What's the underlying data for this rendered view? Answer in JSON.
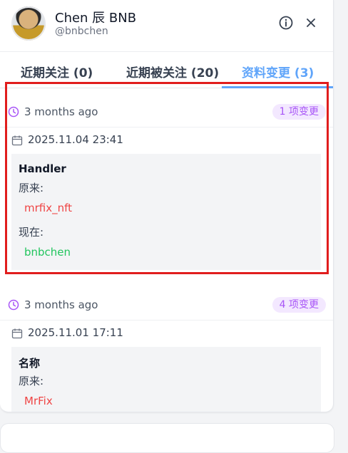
{
  "profile": {
    "name": "Chen 辰 BNB",
    "handle": "@bnbchen"
  },
  "header_icons": [
    "info-icon",
    "close-icon"
  ],
  "tabs": [
    {
      "label": "近期关注 (0)",
      "active": false
    },
    {
      "label": "近期被关注 (20)",
      "active": false
    },
    {
      "label": "资料变更 (3)",
      "active": true
    }
  ],
  "entries": [
    {
      "ago": "3 months ago",
      "badge": "1 项变更",
      "date": "2025.11.04 23:41",
      "field": "Handler",
      "old_label": "原来:",
      "old_value": "mrfix_nft",
      "new_label": "现在:",
      "new_value": "bnbchen"
    },
    {
      "ago": "3 months ago",
      "badge": "4 项变更",
      "date": "2025.11.01 17:11",
      "field": "名称",
      "old_label": "原来:",
      "old_value": "MrFix"
    }
  ],
  "colors": {
    "accent": "#60a5fa",
    "badge_bg": "#f3e8ff",
    "badge_text": "#a855f7",
    "old_value": "#ef4444",
    "new_value": "#22c55e",
    "highlight": "#e11d1d"
  }
}
